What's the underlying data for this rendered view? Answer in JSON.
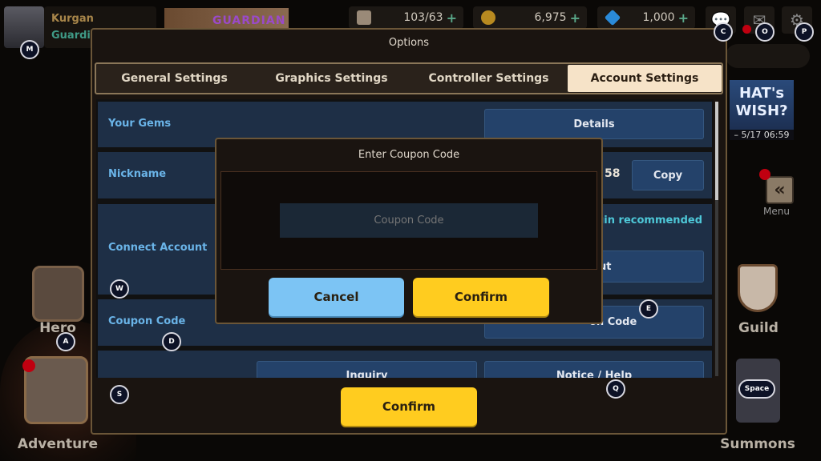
{
  "player": {
    "name": "Kurgan",
    "title": "Guardia",
    "banner": "GUARDIAN"
  },
  "resources": [
    {
      "icon": "coffee-icon",
      "value": "103/63"
    },
    {
      "icon": "gold-coin-icon",
      "value": "6,975"
    },
    {
      "icon": "gem-icon",
      "value": "1,000"
    }
  ],
  "keys": {
    "M": "M",
    "C": "C",
    "O": "O",
    "P": "P",
    "W": "W",
    "A": "A",
    "D": "D",
    "S": "S",
    "E": "E",
    "Q": "Q",
    "Space": "Space"
  },
  "options": {
    "title": "Options",
    "tabs": [
      {
        "label": "General Settings"
      },
      {
        "label": "Graphics Settings"
      },
      {
        "label": "Controller Settings"
      },
      {
        "label": "Account Settings",
        "active": true
      }
    ],
    "rows": {
      "gems": {
        "label": "Your Gems",
        "button": "Details"
      },
      "nickname": {
        "label": "Nickname",
        "value_fragment": "58",
        "button": "Copy"
      },
      "connect": {
        "label": "Connect Account",
        "hint_fragment": "ogin recommended",
        "button_fragment": "ut"
      },
      "coupon": {
        "label": "Coupon Code",
        "button_fragment": "on Code"
      },
      "support": {
        "inquiry": "Inquiry",
        "notice": "Notice / Help"
      }
    },
    "confirm": "Confirm"
  },
  "coupon_dialog": {
    "title": "Enter Coupon Code",
    "placeholder": "Coupon Code",
    "cancel": "Cancel",
    "confirm": "Confirm"
  },
  "side": {
    "hero": "Hero",
    "adventure": "Adventure",
    "guild": "Guild",
    "summons": "Summons",
    "menu": "Menu",
    "event_banner": "HAT's WISH?",
    "event_time": "– 5/17 06:59"
  },
  "colors": {
    "accent_yellow": "#ffcc1f",
    "cancel_blue": "#7cc4f4",
    "label_blue": "#6ab4e8",
    "hint_teal": "#4ec8d8",
    "active_tab": "#f6e3c8"
  }
}
